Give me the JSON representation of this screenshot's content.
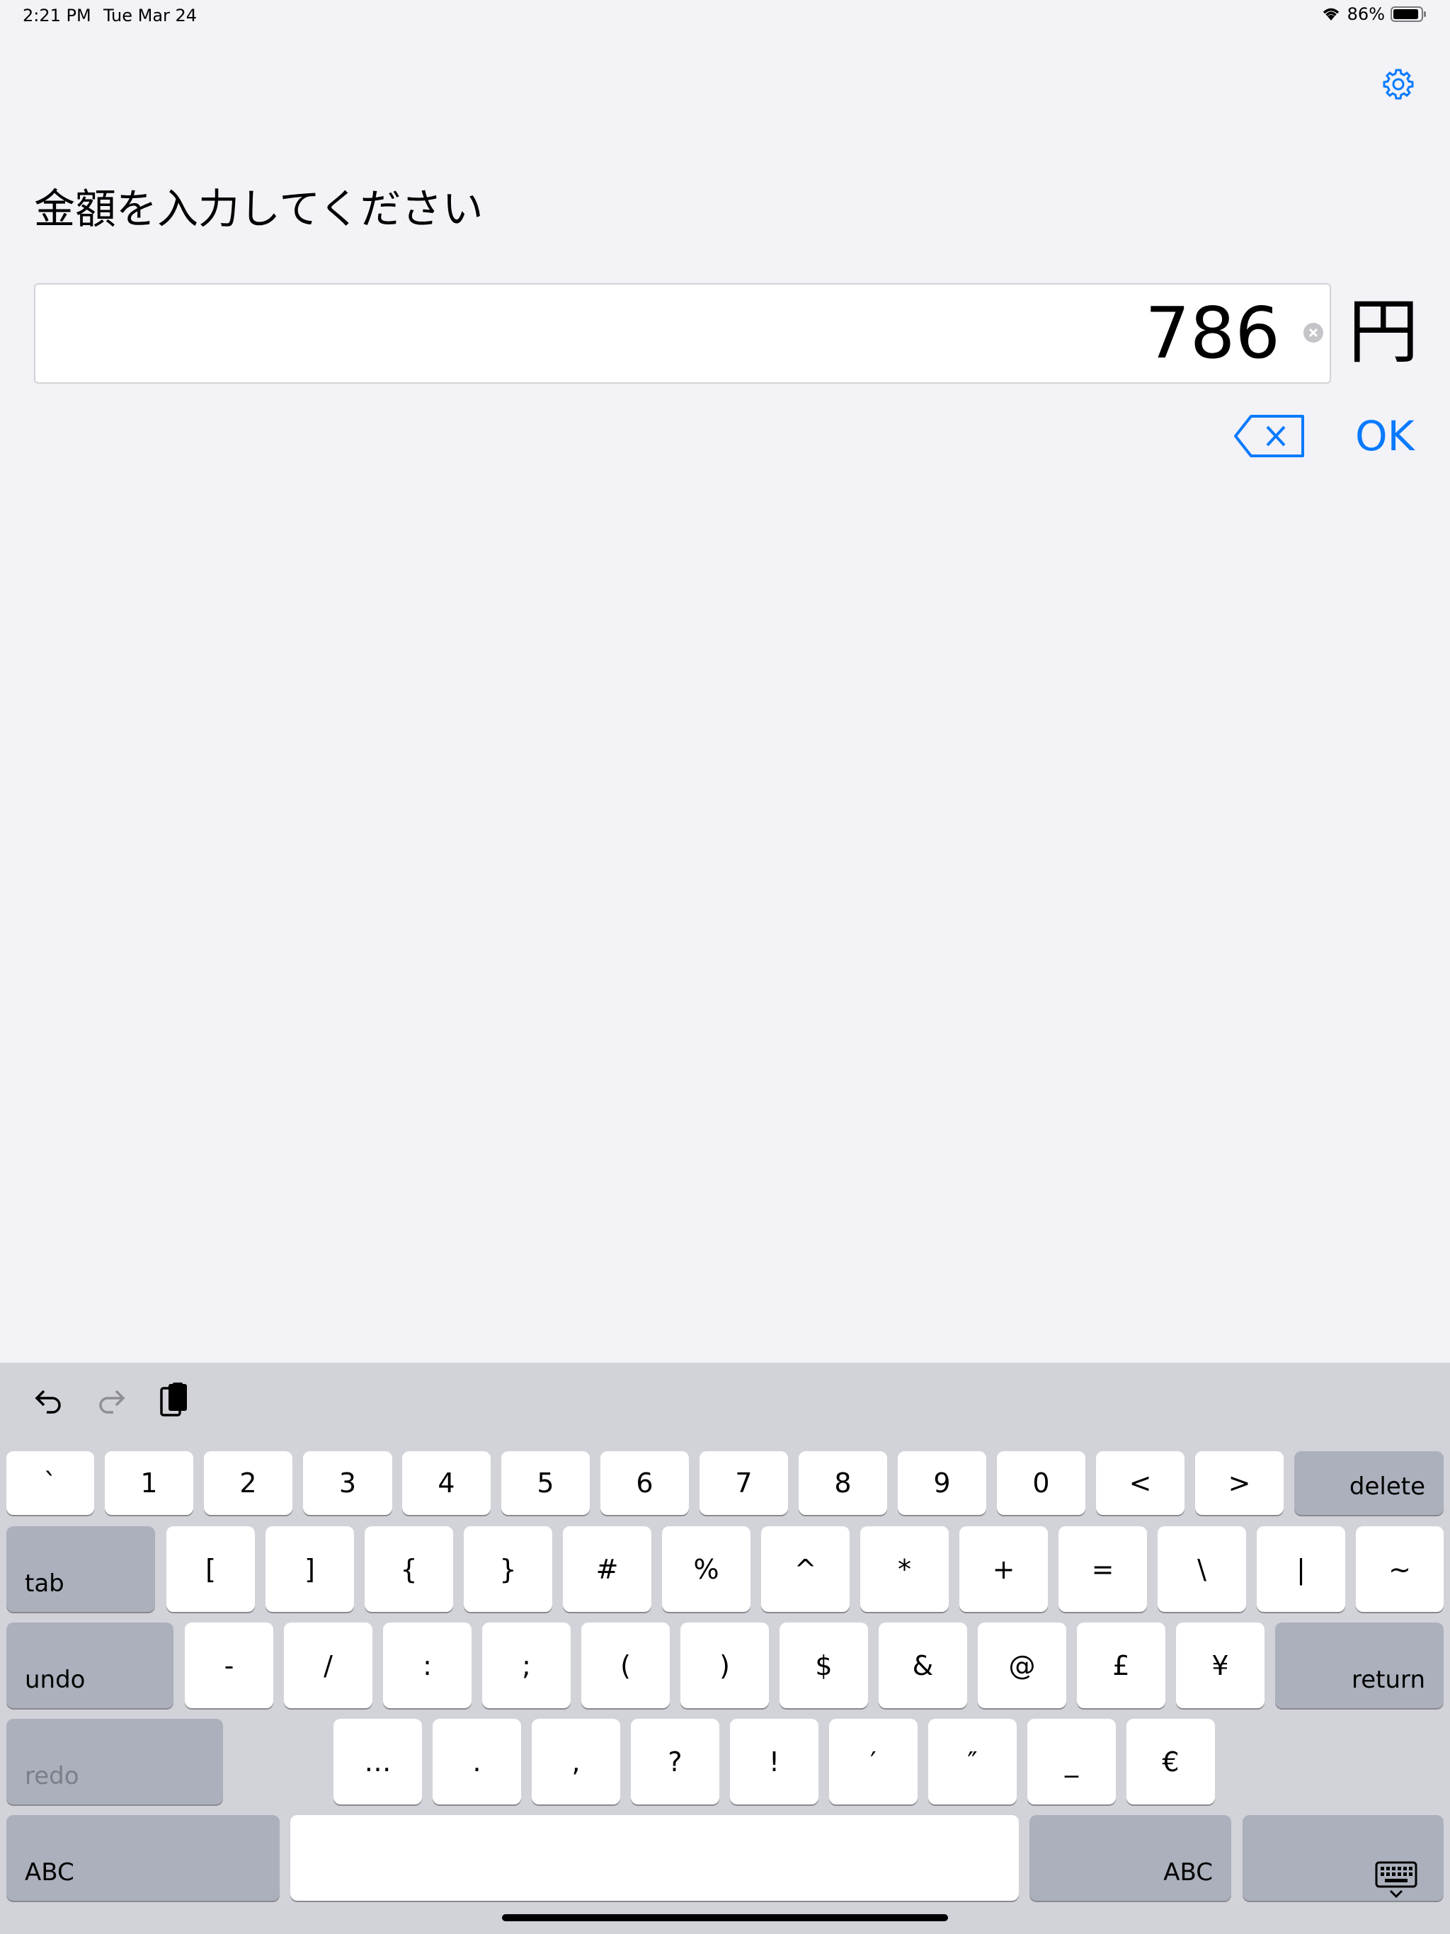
{
  "status": {
    "time": "2:21 PM",
    "date": "Tue Mar 24",
    "battery": "86%"
  },
  "colors": {
    "accent": "#0a7aff",
    "background": "#f2f2f7",
    "keyboard_bg": "#d1d3d9"
  },
  "prompt": "金額を入力してください",
  "amount": {
    "value": "786",
    "unit": "円"
  },
  "actions": {
    "ok_label": "OK",
    "backspace_icon": "backspace-icon",
    "settings_icon": "gear-icon"
  },
  "keyboard": {
    "row1": [
      "`",
      "1",
      "2",
      "3",
      "4",
      "5",
      "6",
      "7",
      "8",
      "9",
      "0",
      "<",
      ">"
    ],
    "delete_label": "delete",
    "tab_label": "tab",
    "row2": [
      "[",
      "]",
      "{",
      "}",
      "#",
      "%",
      "^",
      "*",
      "+",
      "=",
      "\\",
      "|",
      "~"
    ],
    "undo_label": "undo",
    "row3": [
      "-",
      "/",
      ":",
      ";",
      "(",
      ")",
      "$",
      "&",
      "@",
      "£",
      "¥"
    ],
    "return_label": "return",
    "redo_label": "redo",
    "row4": [
      "…",
      ".",
      ",",
      "?",
      "!",
      "′",
      "″",
      "_",
      "€"
    ],
    "abc_left_label": "ABC",
    "abc_right_label": "ABC"
  }
}
